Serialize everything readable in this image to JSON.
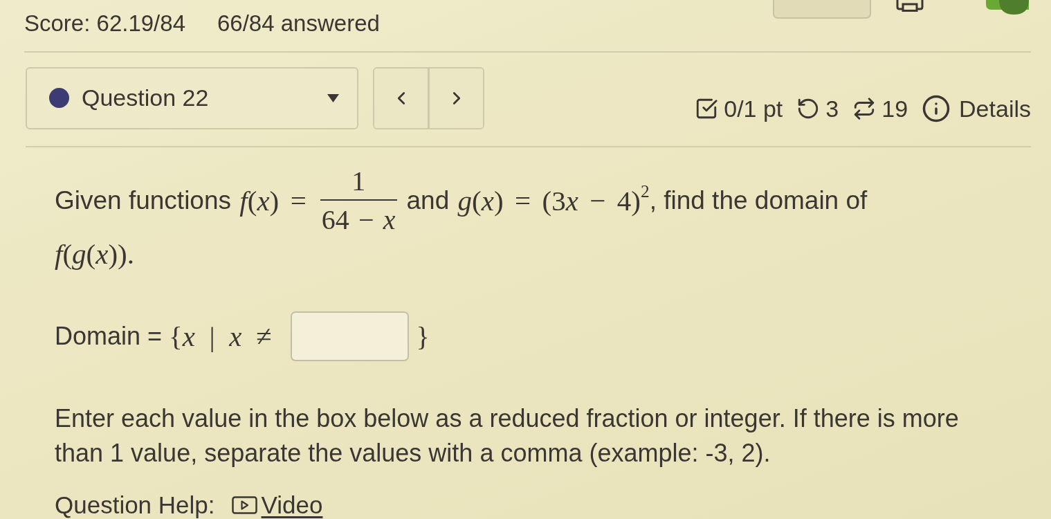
{
  "header": {
    "score": "Score: 62.19/84",
    "answered": "66/84 answered"
  },
  "toggle": {
    "on": true
  },
  "question_select": {
    "label": "Question 22"
  },
  "stats": [
    {
      "kind": "points",
      "text": "0/1 pt"
    },
    {
      "kind": "attempts",
      "text": "3"
    },
    {
      "kind": "versions",
      "text": "19"
    },
    {
      "kind": "details",
      "text": "Details"
    }
  ],
  "prompt": {
    "lines": [
      [
        {
          "kind": "text",
          "text": "Given functions"
        },
        {
          "kind": "math",
          "text": "f(x) ="
        },
        {
          "kind": "fraction",
          "numerator": "1",
          "denominator": "64 − x"
        },
        {
          "kind": "text",
          "text": "and"
        },
        {
          "kind": "math",
          "text": "g(x) = (3x − 4)",
          "sup": "2"
        },
        {
          "kind": "text",
          "text": ", find the domain of"
        }
      ],
      [
        {
          "kind": "math",
          "text": "f(g(x))."
        }
      ]
    ]
  },
  "answer": {
    "label": "Domain =",
    "math_before": "{x | x ≠",
    "math_after": "}"
  },
  "instructions": "Enter each value in the box below as a reduced fraction or integer. If there is more than 1 value, separate the values with a comma (example: -3, 2).",
  "help": {
    "label": "Question Help:",
    "links": [
      {
        "kind": "video",
        "text": "Video"
      }
    ]
  }
}
